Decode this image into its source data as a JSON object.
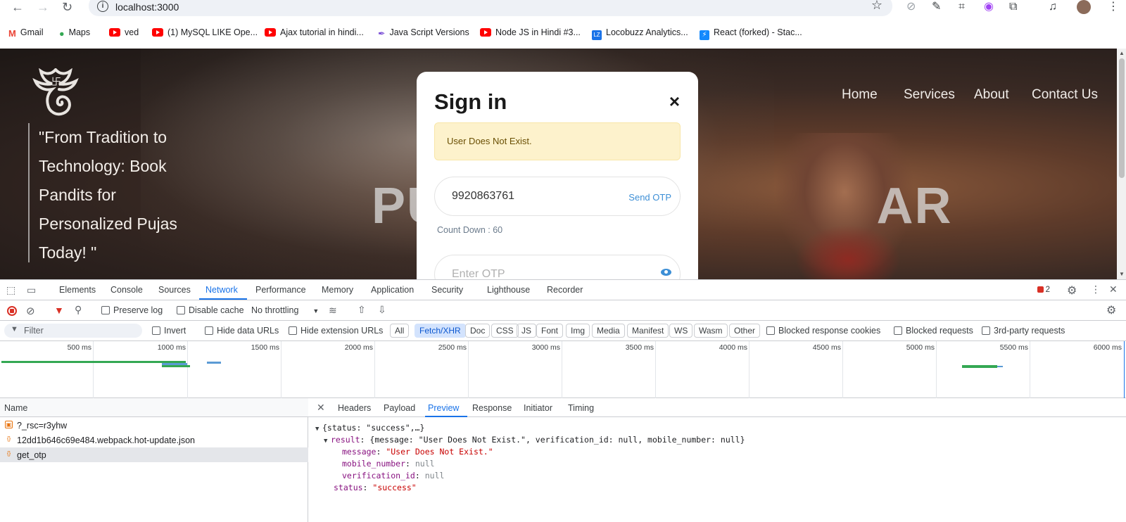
{
  "browser": {
    "url": "localhost:3000",
    "bookmarks": [
      {
        "label": "Gmail",
        "icon": "gmail-icon"
      },
      {
        "label": "Maps",
        "icon": "maps-icon"
      },
      {
        "label": "ved",
        "icon": "youtube-icon"
      },
      {
        "label": "(1) MySQL LIKE Ope...",
        "icon": "youtube-icon"
      },
      {
        "label": "Ajax tutorial in hindi...",
        "icon": "youtube-icon"
      },
      {
        "label": "Java Script Versions",
        "icon": "feather-icon"
      },
      {
        "label": "Node JS in Hindi #3...",
        "icon": "youtube-icon"
      },
      {
        "label": "Locobuzz Analytics...",
        "icon": "locobuzz-icon"
      },
      {
        "label": "React (forked) - Stac...",
        "icon": "stackblitz-icon"
      }
    ]
  },
  "site": {
    "quote": [
      "\"From Tradition to",
      "Technology: Book",
      "Pandits for",
      "Personalized Pujas",
      "Today! \""
    ],
    "hero_title": "PU                            AR",
    "nav": [
      "Home",
      "Services",
      "About",
      "Contact Us"
    ]
  },
  "modal": {
    "title": "Sign in",
    "close": "×",
    "alert": "User Does Not Exist.",
    "phone_value": "9920863761",
    "send_otp": "Send OTP",
    "countdown": "Count Down : 60",
    "otp_placeholder": "Enter OTP"
  },
  "devtools": {
    "tabs": [
      "Elements",
      "Console",
      "Sources",
      "Network",
      "Performance",
      "Memory",
      "Application",
      "Security",
      "Lighthouse",
      "Recorder"
    ],
    "active_tab": "Network",
    "issues_count": "2",
    "toolbar": {
      "preserve_log": "Preserve log",
      "disable_cache": "Disable cache",
      "throttling": "No throttling"
    },
    "filter": {
      "placeholder": "Filter",
      "invert": "Invert",
      "hide_data_urls": "Hide data URLs",
      "hide_extension_urls": "Hide extension URLs",
      "types": [
        "All",
        "Fetch/XHR",
        "Doc",
        "CSS",
        "JS",
        "Font",
        "Img",
        "Media",
        "Manifest",
        "WS",
        "Wasm",
        "Other"
      ],
      "active_type": "Fetch/XHR",
      "blocked_cookies": "Blocked response cookies",
      "blocked_requests": "Blocked requests",
      "third_party": "3rd-party requests"
    },
    "timeline_ticks": [
      "500 ms",
      "1000 ms",
      "1500 ms",
      "2000 ms",
      "2500 ms",
      "3000 ms",
      "3500 ms",
      "4000 ms",
      "4500 ms",
      "5000 ms",
      "5500 ms",
      "6000 ms"
    ],
    "requests_header": "Name",
    "requests": [
      "?_rsc=r3yhw",
      "12dd1b646c69e484.webpack.hot-update.json",
      "get_otp"
    ],
    "selected_request": "get_otp",
    "detail_tabs": [
      "Headers",
      "Payload",
      "Preview",
      "Response",
      "Initiator",
      "Timing"
    ],
    "active_detail_tab": "Preview",
    "preview": {
      "summary": "{status: \"success\",…}",
      "result_summary": "{message: \"User Does Not Exist.\", verification_id: null, mobile_number: null}",
      "message": "\"User Does Not Exist.\"",
      "mobile_number": "null",
      "verification_id": "null",
      "status": "\"success\""
    }
  }
}
